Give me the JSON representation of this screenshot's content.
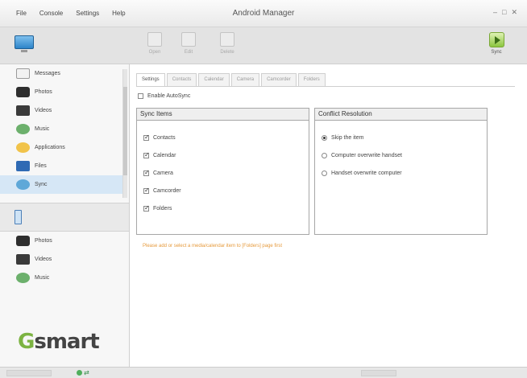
{
  "window": {
    "title": "Android Manager",
    "menu": [
      "File",
      "Console",
      "Settings",
      "Help"
    ],
    "controls": [
      "–",
      "□",
      "✕"
    ]
  },
  "toolbar": {
    "buttons": [
      "Open",
      "Edit",
      "Delete"
    ],
    "sync_label": "Sync"
  },
  "sidebar": {
    "items": [
      "Messages",
      "Photos",
      "Videos",
      "Music",
      "Applications",
      "Files",
      "Sync"
    ],
    "selected": "Sync",
    "device_items": [
      "Photos",
      "Videos",
      "Music"
    ]
  },
  "brand": {
    "logo_g": "G",
    "logo_rest": "smart"
  },
  "tabs": [
    "Settings",
    "Contacts",
    "Calendar",
    "Camera",
    "Camcorder",
    "Folders"
  ],
  "settings": {
    "enable_label": "Enable AutoSync",
    "enable_checked": false,
    "sync_items_header": "Sync Items",
    "sync_items": [
      "Contacts",
      "Calendar",
      "Camera",
      "Camcorder",
      "Folders"
    ],
    "conflict_header": "Conflict Resolution",
    "conflict_options": [
      "Skip the item",
      "Computer overwrite handset",
      "Handset overwrite computer"
    ],
    "conflict_selected": 0
  },
  "hint_text": "Please add or select a media/calendar item to [Folders] page first",
  "status": {
    "connection": "⇄"
  },
  "colors": {
    "accent": "#7cb342",
    "hint": "#e69a3c",
    "selection": "#d6e7f6"
  }
}
